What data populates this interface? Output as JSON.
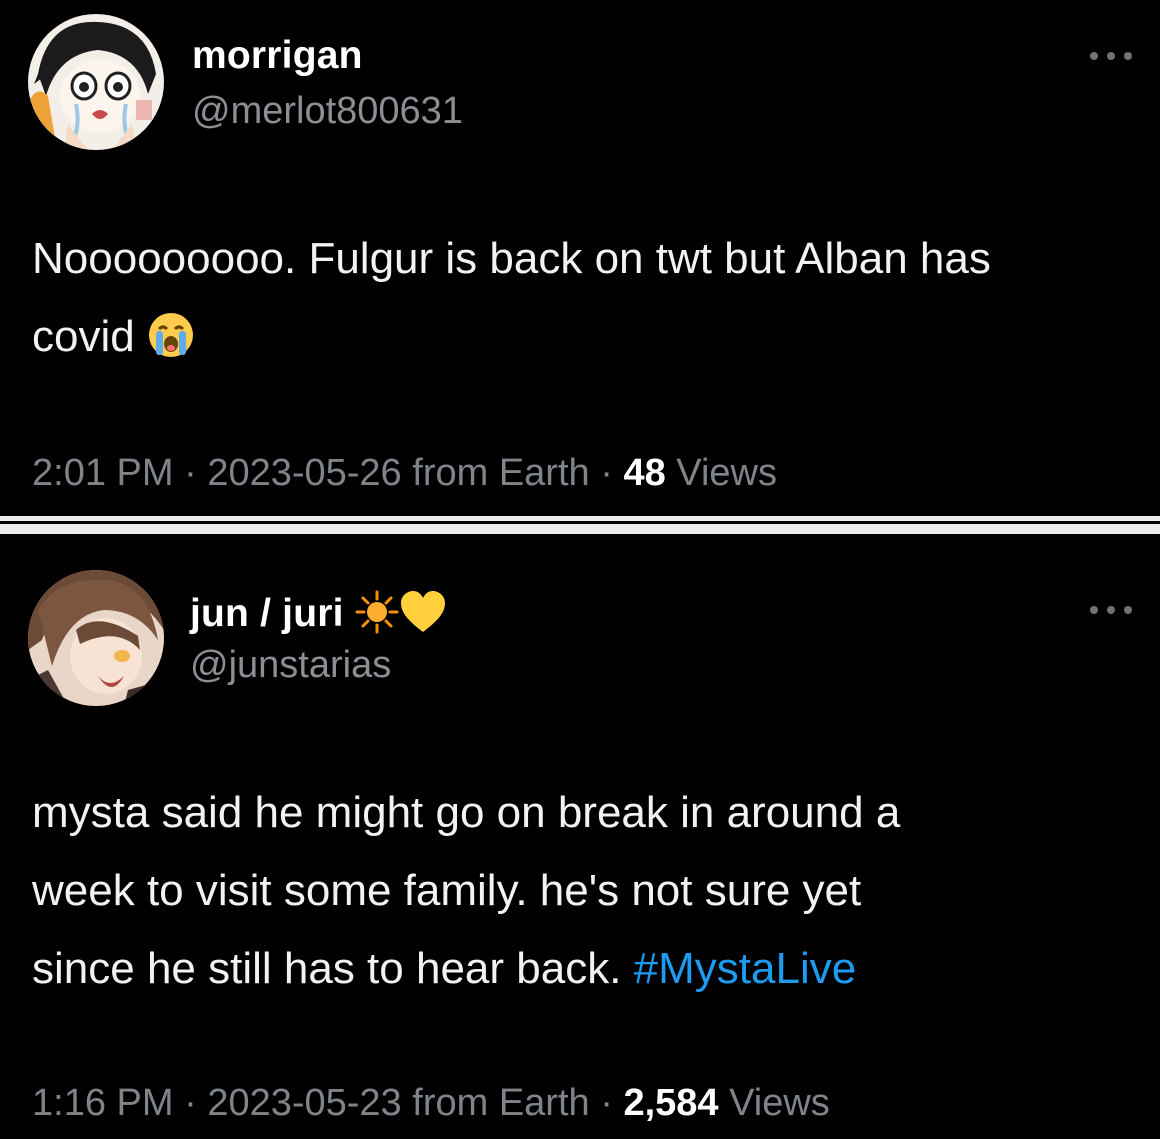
{
  "tweets": [
    {
      "display_name": "morrigan",
      "handle": "@merlot800631",
      "text": "Nooooooooo. Fulgur is back on twt but Alban has\ncovid ",
      "emoji": "loudly-crying-face",
      "time": "2:01 PM",
      "date": "2023-05-26",
      "source": "from Earth",
      "separator": "·",
      "views_count": "48",
      "views_label": "Views",
      "more_icon": "ellipsis-icon"
    },
    {
      "display_name": "jun / juri",
      "name_emojis": [
        "sun-icon",
        "yellow-heart-icon"
      ],
      "handle": "@junstarias",
      "text": "mysta said he might go on break in around a\nweek to visit some family. he's not sure yet\nsince he still has to hear back. ",
      "hashtag": "#MystaLive",
      "time": "1:16 PM",
      "date": "2023-05-23",
      "source": "from Earth",
      "separator": "·",
      "views_count": "2,584",
      "views_label": "Views",
      "more_icon": "ellipsis-icon"
    }
  ],
  "colors": {
    "background": "#000000",
    "text": "#f1f2f3",
    "secondary": "#8b8f94",
    "hashtag": "#1d9bf0",
    "divider": "#ececec"
  }
}
